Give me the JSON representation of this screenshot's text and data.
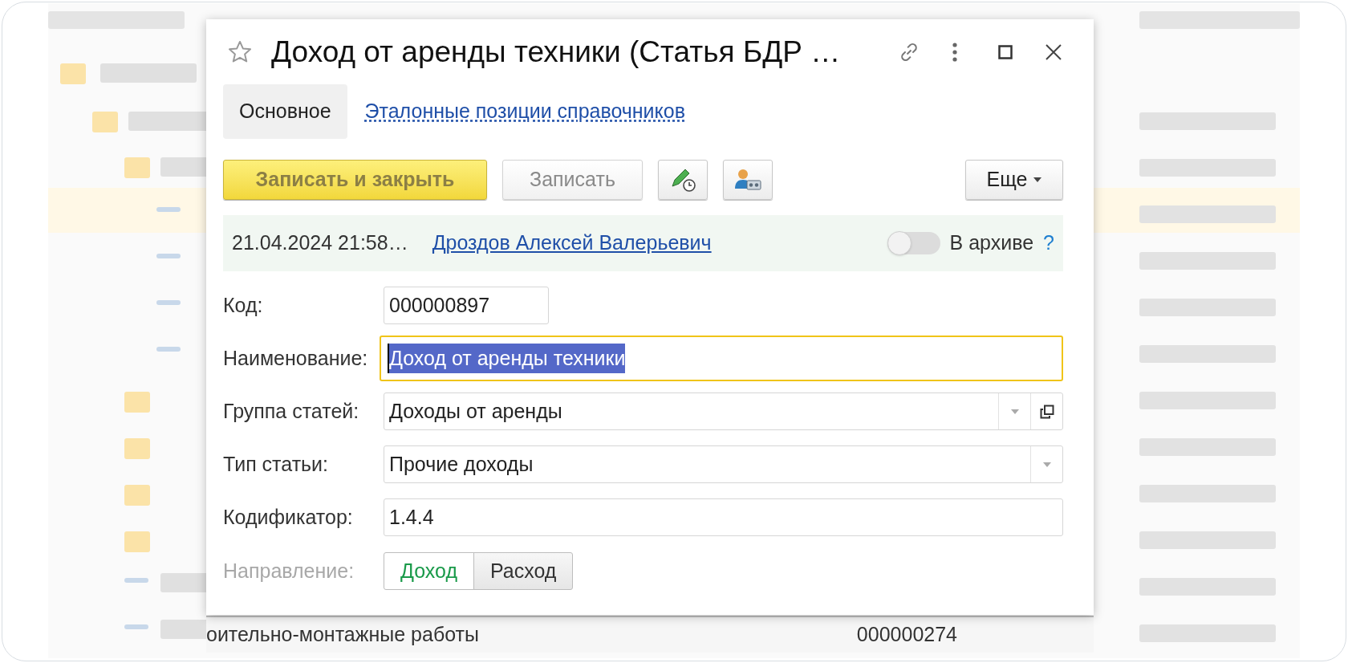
{
  "window": {
    "title": "Доход от аренды техники (Статья БДР …"
  },
  "tabs": [
    {
      "label": "Основное",
      "selected": true
    },
    {
      "label": "Эталонные позиции справочников",
      "selected": false
    }
  ],
  "toolbar": {
    "buttons": [
      {
        "kind": "primary",
        "label": "Записать и закрыть"
      },
      {
        "kind": "plain",
        "label": "Записать"
      }
    ],
    "more": "Еще"
  },
  "info": {
    "date": "21.04.2024 21:58…",
    "author": "Дроздов Алексей Валерьевич",
    "archive": {
      "label": "В архиве",
      "on": false
    },
    "help": "?"
  },
  "fields": [
    {
      "kind": "short",
      "label": "Код:",
      "value": "000000897",
      "focused": false
    },
    {
      "kind": "text",
      "label": "Наименование:",
      "value": "Доход от аренды техники",
      "focused": true
    },
    {
      "kind": "select-open",
      "label": "Группа статей:",
      "value": "Доходы от аренды",
      "focused": false
    },
    {
      "kind": "select",
      "label": "Тип статьи:",
      "value": "Прочие доходы",
      "focused": false
    },
    {
      "kind": "text",
      "label": "Кодификатор:",
      "value": "1.4.4",
      "focused": false
    }
  ],
  "direction": {
    "label": "Направление:",
    "options": [
      {
        "label": "Доход",
        "selected": true
      },
      {
        "label": "Расход",
        "selected": false
      }
    ]
  },
  "background_row": {
    "name": "оительно-монтажные работы",
    "code": "000000274"
  }
}
